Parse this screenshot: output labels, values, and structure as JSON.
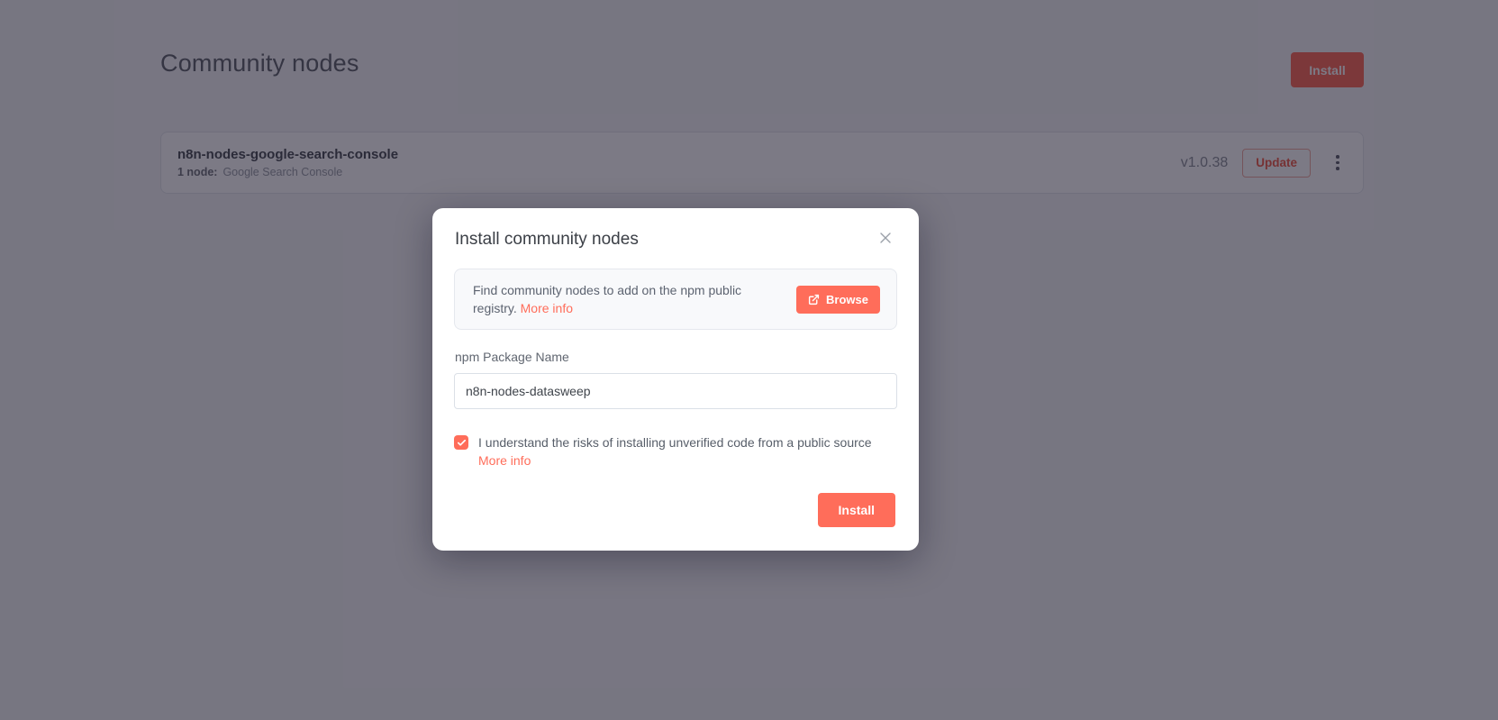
{
  "colors": {
    "accent": "#ff6d5a",
    "overlay": "rgba(16,12,32,0.55)",
    "page_background": "#f5f6f8"
  },
  "page": {
    "title": "Community nodes",
    "install_button": "Install",
    "package": {
      "name": "n8n-nodes-google-search-console",
      "nodes_label": "1 node:",
      "nodes_value": "Google Search Console",
      "version": "v1.0.38",
      "update_button": "Update",
      "kebab_menu": "more-options"
    }
  },
  "modal": {
    "title": "Install community nodes",
    "close_icon": "close-x",
    "callout": {
      "text": "Find community nodes to add on the npm public registry.",
      "more_info_label": "More info",
      "browse_button": "Browse",
      "browse_icon": "external-link"
    },
    "package_field": {
      "label": "npm Package Name",
      "value": "n8n-nodes-datasweep"
    },
    "risk_checkbox": {
      "checked": "true",
      "label": "I understand the risks of installing unverified code from a public source",
      "more_info_label": "More info"
    },
    "install_button": "Install"
  }
}
